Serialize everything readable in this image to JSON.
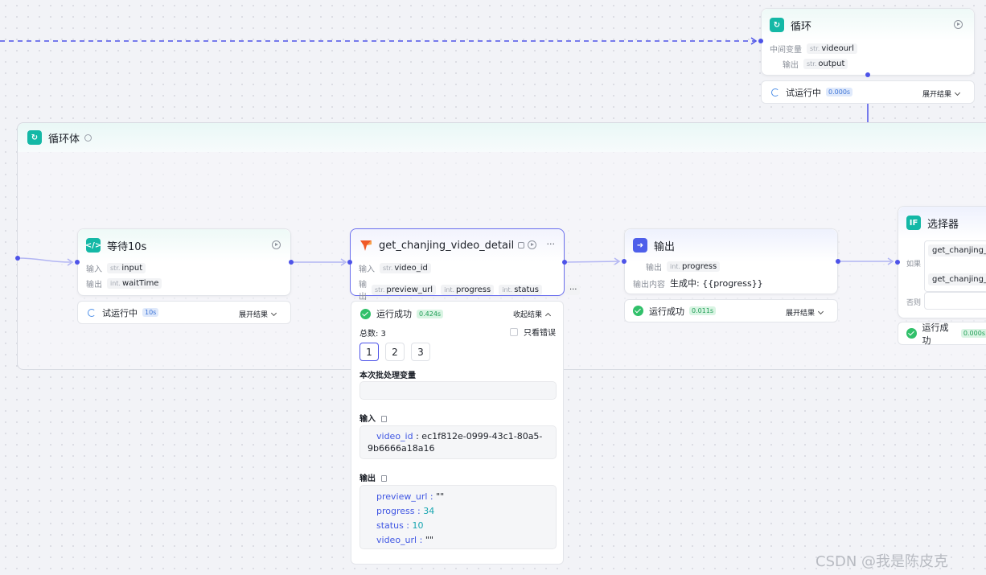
{
  "loop_node": {
    "title": "循环",
    "mid_var_label": "中间变量",
    "mid_var_type": "str.",
    "mid_var_name": "videourl",
    "output_label": "输出",
    "output_type": "str.",
    "output_name": "output",
    "status_text": "试运行中",
    "status_time": "0.000s",
    "expand_label": "展开结果"
  },
  "loop_body": {
    "title": "循环体"
  },
  "wait_node": {
    "title": "等待10s",
    "input_label": "输入",
    "input_type": "str.",
    "input_name": "input",
    "output_label": "输出",
    "output_type": "int.",
    "output_name": "waitTime",
    "status_text": "试运行中",
    "status_time": "10s",
    "expand_label": "展开结果"
  },
  "plugin_node": {
    "title": "get_chanjing_video_detail",
    "input_label": "输入",
    "input_type": "str.",
    "input_name": "video_id",
    "output_label": "输出",
    "outputs": [
      {
        "type": "str.",
        "name": "preview_url"
      },
      {
        "type": "int.",
        "name": "progress"
      },
      {
        "type": "int.",
        "name": "status"
      }
    ],
    "more": "···",
    "status_text": "运行成功",
    "status_time": "0.424s",
    "collapse_label": "收起结果",
    "total_label": "总数: 3",
    "only_errors": "只看错误",
    "batches": [
      "1",
      "2",
      "3"
    ],
    "batch_var_title": "本次批处理变量",
    "input_title": "输入",
    "input_key": "video_id",
    "input_value": "ec1f812e-0999-43c1-80a5-",
    "input_value_2": "9b6666a18a16",
    "output_title": "输出",
    "output_items": [
      {
        "key": "preview_url",
        "value": "\"\""
      },
      {
        "key": "progress",
        "value": "34"
      },
      {
        "key": "status",
        "value": "10"
      },
      {
        "key": "video_url",
        "value": "\"\""
      }
    ]
  },
  "output_node": {
    "title": "输出",
    "input_label": "输出",
    "input_type": "int.",
    "input_name": "progress",
    "content_label": "输出内容",
    "content_value": "生成中: {{progress}}",
    "status_text": "运行成功",
    "status_time": "0.011s",
    "expand_label": "展开结果"
  },
  "selector_node": {
    "title": "选择器",
    "if_label": "如果",
    "cond1": "get_chanjing_vi",
    "cond2": "get_chanjing_vi",
    "else_label": "否则",
    "status_text": "运行成功",
    "status_time": "0.000s"
  },
  "watermark": "CSDN @我是陈皮克",
  "colors": {
    "edge": "#4d53e8",
    "teal_icon": "#14b8a6",
    "success": "#31c06a"
  }
}
